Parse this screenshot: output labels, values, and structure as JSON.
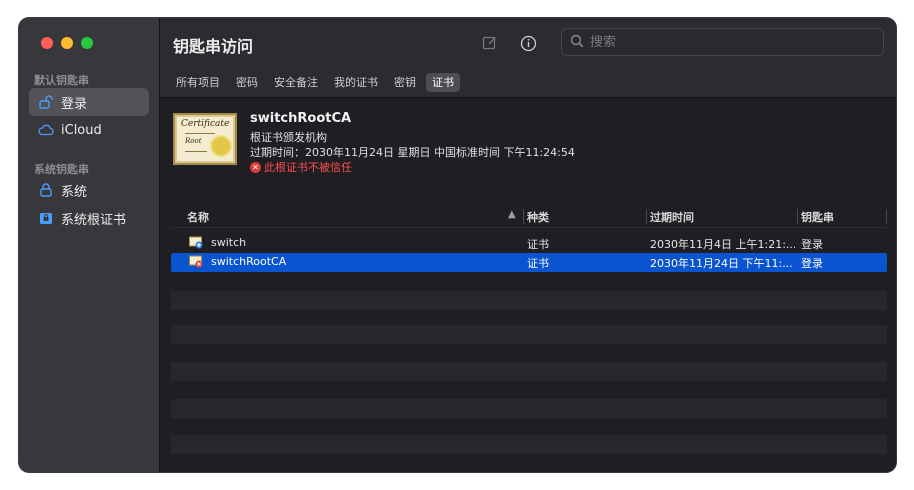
{
  "window": {
    "title": "钥匙串访问"
  },
  "sidebar": {
    "section_default": "默认钥匙串",
    "section_system": "系统钥匙串",
    "items": [
      {
        "label": "登录",
        "icon": "unlock-icon",
        "active": true
      },
      {
        "label": "iCloud",
        "icon": "cloud-icon",
        "active": false
      },
      {
        "label": "系统",
        "icon": "lock-icon",
        "active": false
      },
      {
        "label": "系统根证书",
        "icon": "lock-cabinet-icon",
        "active": false
      }
    ]
  },
  "toolbar": {
    "search_placeholder": "搜索",
    "icons": [
      "compose-icon",
      "info-icon",
      "search-icon"
    ]
  },
  "tabs": [
    "所有项目",
    "密码",
    "安全备注",
    "我的证书",
    "密钥",
    "证书"
  ],
  "active_tab": "证书",
  "detail": {
    "name": "switchRootCA",
    "kind": "根证书颁发机构",
    "expires": "过期时间：2030年11月24日 星期日 中国标准时间 下午11:24:54",
    "warning": "此根证书不被信任",
    "thumb_text_1": "Certificate",
    "thumb_text_2": "Root"
  },
  "table": {
    "columns": [
      "名称",
      "种类",
      "过期时间",
      "钥匙串"
    ],
    "rows": [
      {
        "name": "switch",
        "kind": "证书",
        "expires": "2030年11月4日 上午1:21:...",
        "keychain": "登录",
        "selected": false
      },
      {
        "name": "switchRootCA",
        "kind": "证书",
        "expires": "2030年11月24日 下午11:...",
        "keychain": "登录",
        "selected": true
      }
    ]
  },
  "colors": {
    "accent_selection": "#0a54cf",
    "warning": "#ff4d4d"
  }
}
